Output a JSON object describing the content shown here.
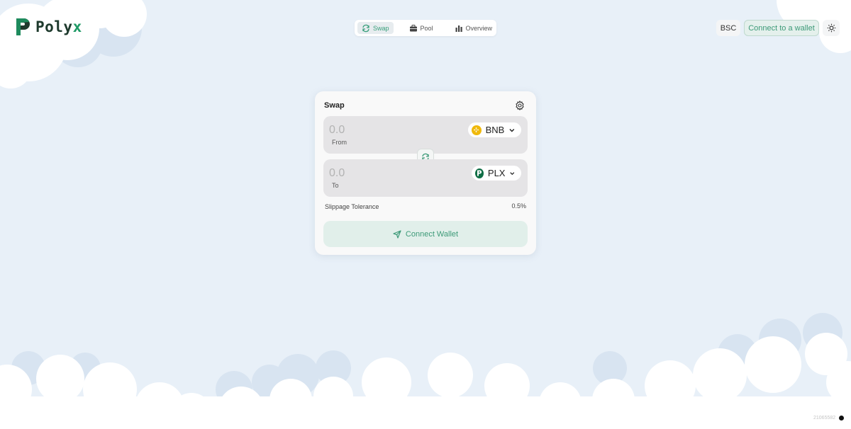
{
  "app": {
    "brand_main": "Poly",
    "brand_accent": "x"
  },
  "colors": {
    "accent": "#3d9a78",
    "brand_dark": "#1e3a2d",
    "background": "#e8f0f8",
    "card": "#f9f9f9",
    "field": "#e5e4e6"
  },
  "nav": {
    "tabs": [
      {
        "label": "Swap",
        "icon": "swap-icon",
        "active": true
      },
      {
        "label": "Pool",
        "icon": "briefcase-icon",
        "active": false
      },
      {
        "label": "Overview",
        "icon": "bar-chart-icon",
        "active": false
      }
    ]
  },
  "header": {
    "network_label": "BSC",
    "connect_label": "Connect to a wallet",
    "theme_icon": "sun-icon"
  },
  "swap": {
    "title": "Swap",
    "settings_icon": "gear-icon",
    "from": {
      "placeholder": "0.0",
      "label": "From",
      "token": "BNB",
      "token_icon": "bnb-icon"
    },
    "to": {
      "placeholder": "0.0",
      "label": "To",
      "token": "PLX",
      "token_icon": "plx-icon"
    },
    "switch_icon": "refresh-icon",
    "slippage_label": "Slippage Tolerance",
    "slippage_value": "0.5%",
    "connect_label": "Connect Wallet",
    "connect_icon": "send-icon"
  },
  "footer": {
    "build_id": "21065582"
  }
}
